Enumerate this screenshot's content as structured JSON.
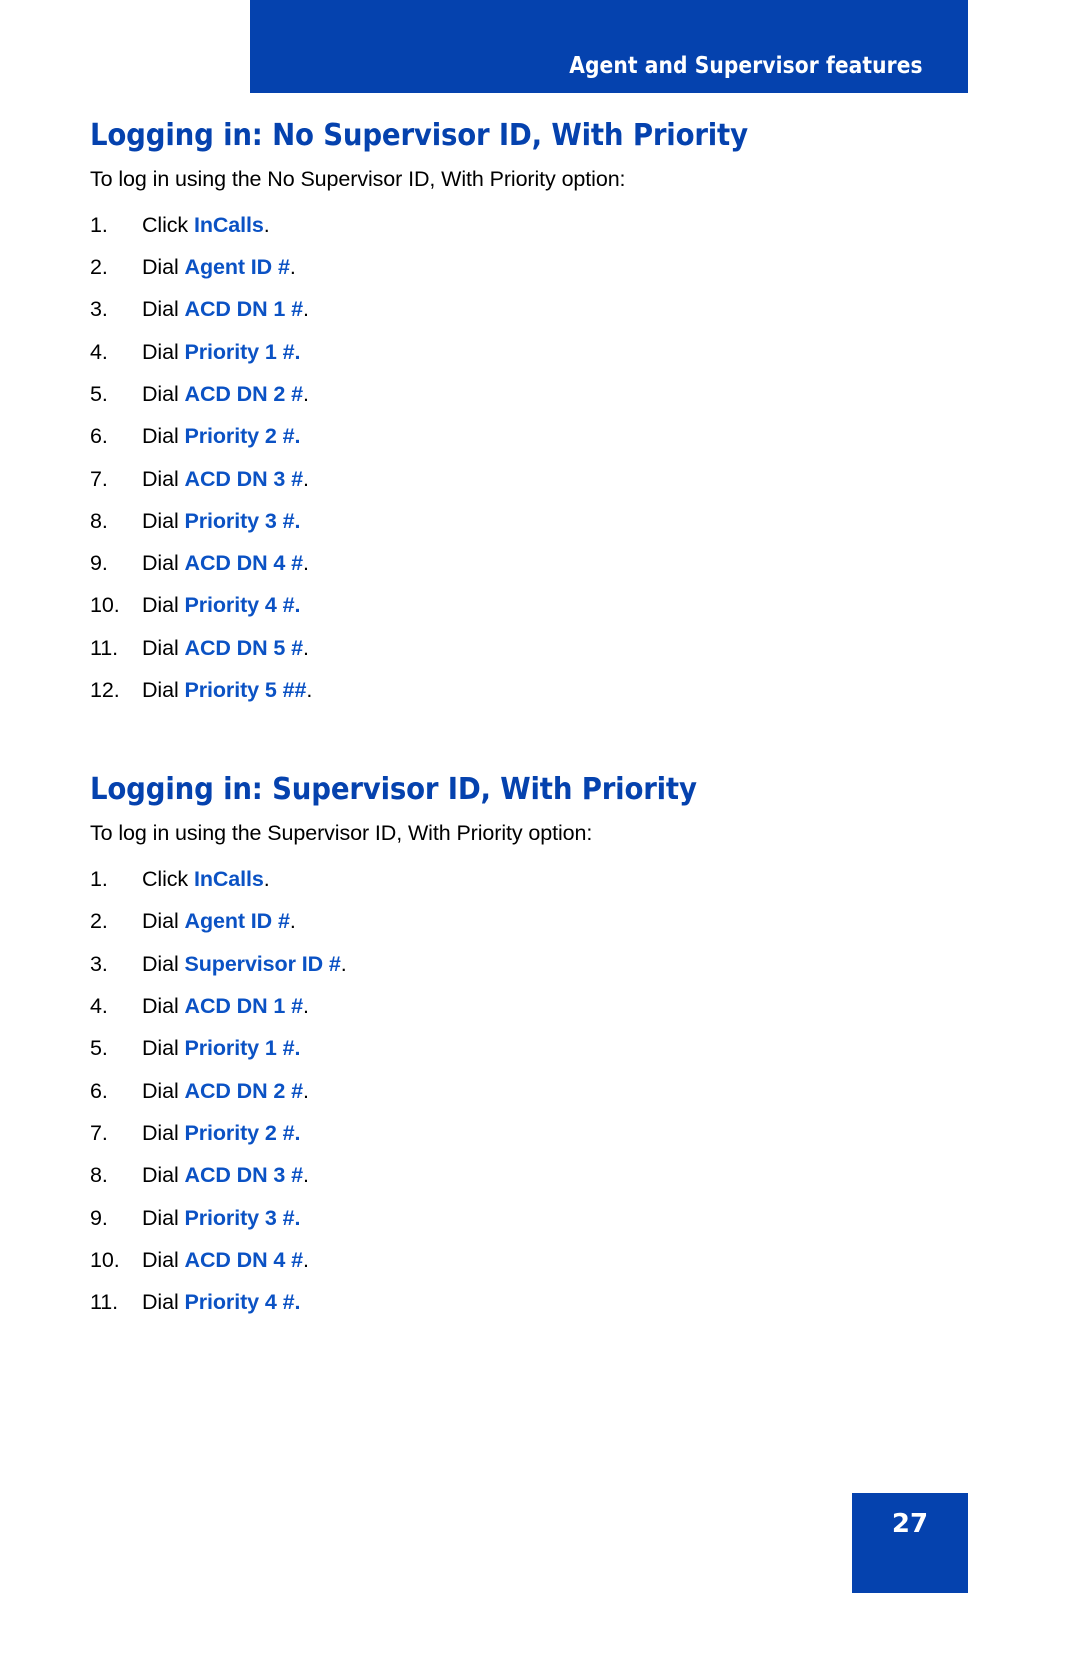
{
  "header": {
    "title": "Agent and Supervisor features",
    "bar_color": "#0542AE",
    "text_color": "#FFFFFF"
  },
  "colors": {
    "accent_blue": "#0542AE",
    "keyword_blue": "#0B52C4",
    "body_black": "#000000"
  },
  "sections": [
    {
      "heading": "Logging in: No Supervisor ID, With Priority",
      "intro": "To log in using the No Supervisor ID, With Priority option:",
      "steps": [
        {
          "num": "1.",
          "verb": "Click ",
          "keyword": "InCalls",
          "terminator": ".",
          "terminator_style": "black"
        },
        {
          "num": "2.",
          "verb": "Dial ",
          "keyword": "Agent ID #",
          "terminator": ".",
          "terminator_style": "black"
        },
        {
          "num": "3.",
          "verb": "Dial ",
          "keyword": "ACD DN 1 #",
          "terminator": ".",
          "terminator_style": "black"
        },
        {
          "num": "4.",
          "verb": "Dial ",
          "keyword": "Priority 1 #",
          "terminator": ".",
          "terminator_style": "blue"
        },
        {
          "num": "5.",
          "verb": "Dial ",
          "keyword": "ACD DN 2 #",
          "terminator": ".",
          "terminator_style": "black"
        },
        {
          "num": "6.",
          "verb": "Dial ",
          "keyword": "Priority 2 #",
          "terminator": ".",
          "terminator_style": "blue"
        },
        {
          "num": "7.",
          "verb": "Dial ",
          "keyword": "ACD DN 3 #",
          "terminator": ".",
          "terminator_style": "black"
        },
        {
          "num": "8.",
          "verb": "Dial ",
          "keyword": "Priority 3 #",
          "terminator": ".",
          "terminator_style": "blue"
        },
        {
          "num": "9.",
          "verb": "Dial ",
          "keyword": "ACD DN 4 #",
          "terminator": ".",
          "terminator_style": "black"
        },
        {
          "num": "10.",
          "verb": "Dial ",
          "keyword": "Priority 4 #",
          "terminator": ".",
          "terminator_style": "blue"
        },
        {
          "num": "11.",
          "verb": "Dial ",
          "keyword": "ACD DN 5 #",
          "terminator": ".",
          "terminator_style": "black"
        },
        {
          "num": "12.",
          "verb": "Dial ",
          "keyword": "Priority 5 ##",
          "terminator": ".",
          "terminator_style": "black"
        }
      ]
    },
    {
      "heading": "Logging in: Supervisor ID, With Priority",
      "intro": "To log in using the Supervisor ID, With Priority option:",
      "steps": [
        {
          "num": "1.",
          "verb": "Click ",
          "keyword": "InCalls",
          "terminator": ".",
          "terminator_style": "black"
        },
        {
          "num": "2.",
          "verb": "Dial ",
          "keyword": "Agent ID #",
          "terminator": ".",
          "terminator_style": "black"
        },
        {
          "num": "3.",
          "verb": "Dial ",
          "keyword": "Supervisor ID #",
          "terminator": ".",
          "terminator_style": "black"
        },
        {
          "num": "4.",
          "verb": "Dial ",
          "keyword": "ACD DN 1 #",
          "terminator": ".",
          "terminator_style": "black"
        },
        {
          "num": "5.",
          "verb": "Dial ",
          "keyword": "Priority 1 #",
          "terminator": ".",
          "terminator_style": "blue"
        },
        {
          "num": "6.",
          "verb": "Dial ",
          "keyword": "ACD DN 2 #",
          "terminator": ".",
          "terminator_style": "black"
        },
        {
          "num": "7.",
          "verb": "Dial ",
          "keyword": "Priority 2 #",
          "terminator": ".",
          "terminator_style": "blue"
        },
        {
          "num": "8.",
          "verb": "Dial ",
          "keyword": "ACD DN 3 #",
          "terminator": ".",
          "terminator_style": "black"
        },
        {
          "num": "9.",
          "verb": "Dial ",
          "keyword": "Priority 3 #",
          "terminator": ".",
          "terminator_style": "blue"
        },
        {
          "num": "10.",
          "verb": "Dial ",
          "keyword": "ACD DN 4 #",
          "terminator": ".",
          "terminator_style": "black"
        },
        {
          "num": "11.",
          "verb": "Dial ",
          "keyword": "Priority 4 #",
          "terminator": ".",
          "terminator_style": "blue"
        }
      ]
    }
  ],
  "footer": {
    "page_number": "27"
  }
}
